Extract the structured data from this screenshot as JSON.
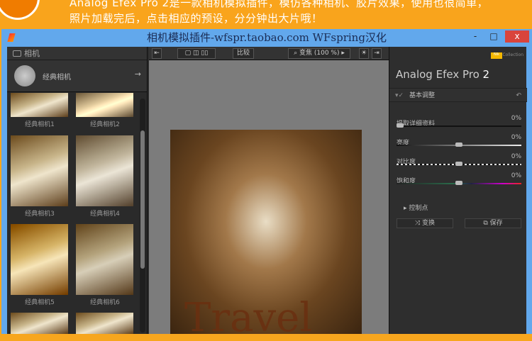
{
  "banner": {
    "line1": "Analog Efex Pro 2是一款相机模拟插件，模仿各种相机、胶片效果，使用也很简单，",
    "line2": "照片加载完后，点击相应的预设，分分钟出大片哦！"
  },
  "window": {
    "title": "相机模拟插件-wfspr.taobao.com  WFspring汉化",
    "minimize": "-",
    "maximize": "□",
    "close": "x"
  },
  "left": {
    "header": "相机",
    "preset": "经典相机",
    "arrow": "→",
    "thumbs": [
      "经典相机1",
      "经典相机2",
      "经典相机3",
      "经典相机4",
      "经典相机5",
      "经典相机6"
    ]
  },
  "toolbar": {
    "compare": "比较",
    "zoom": "变焦 (100 %)"
  },
  "photo": {
    "overlay_text": "Travel"
  },
  "right": {
    "brand": "Nik",
    "collection": "Collection",
    "app_name": "Analog Efex Pro",
    "version": "2",
    "section": "基本调整",
    "sliders": [
      {
        "label": "提取详细资料",
        "value": "0%"
      },
      {
        "label": "亮度",
        "value": "0%"
      },
      {
        "label": "对比度",
        "value": "0%"
      },
      {
        "label": "饱和度",
        "value": "0%"
      }
    ],
    "control_points": "控制点",
    "shuffle": "变换",
    "save": "保存"
  }
}
